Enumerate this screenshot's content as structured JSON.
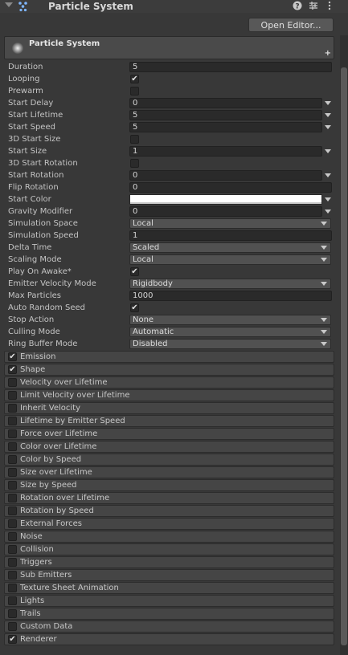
{
  "header": {
    "title": "Particle System",
    "icons": [
      "help-icon",
      "preset-icon",
      "more-icon"
    ]
  },
  "open_editor_label": "Open Editor...",
  "main_module": {
    "title": "Particle System"
  },
  "properties": [
    {
      "label": "Duration",
      "type": "text",
      "value": "5"
    },
    {
      "label": "Looping",
      "type": "checkbox",
      "checked": true
    },
    {
      "label": "Prewarm",
      "type": "checkbox",
      "checked": false
    },
    {
      "label": "Start Delay",
      "type": "text-dropdown",
      "value": "0"
    },
    {
      "label": "Start Lifetime",
      "type": "text-dropdown",
      "value": "5"
    },
    {
      "label": "Start Speed",
      "type": "text-dropdown",
      "value": "5"
    },
    {
      "label": "3D Start Size",
      "type": "checkbox",
      "checked": false
    },
    {
      "label": "Start Size",
      "type": "text-dropdown",
      "value": "1"
    },
    {
      "label": "3D Start Rotation",
      "type": "checkbox",
      "checked": false
    },
    {
      "label": "Start Rotation",
      "type": "text-dropdown",
      "value": "0"
    },
    {
      "label": "Flip Rotation",
      "type": "text",
      "value": "0"
    },
    {
      "label": "Start Color",
      "type": "color",
      "color": "#ffffff"
    },
    {
      "label": "Gravity Modifier",
      "type": "text-dropdown",
      "value": "0"
    },
    {
      "label": "Simulation Space",
      "type": "popup",
      "value": "Local"
    },
    {
      "label": "Simulation Speed",
      "type": "text",
      "value": "1"
    },
    {
      "label": "Delta Time",
      "type": "popup",
      "value": "Scaled"
    },
    {
      "label": "Scaling Mode",
      "type": "popup",
      "value": "Local"
    },
    {
      "label": "Play On Awake*",
      "type": "checkbox",
      "checked": true
    },
    {
      "label": "Emitter Velocity Mode",
      "type": "popup",
      "value": "Rigidbody"
    },
    {
      "label": "Max Particles",
      "type": "text",
      "value": "1000"
    },
    {
      "label": "Auto Random Seed",
      "type": "checkbox",
      "checked": true
    },
    {
      "label": "Stop Action",
      "type": "popup",
      "value": "None"
    },
    {
      "label": "Culling Mode",
      "type": "popup",
      "value": "Automatic"
    },
    {
      "label": "Ring Buffer Mode",
      "type": "popup",
      "value": "Disabled"
    }
  ],
  "modules": [
    {
      "name": "Emission",
      "enabled": true
    },
    {
      "name": "Shape",
      "enabled": true
    },
    {
      "name": "Velocity over Lifetime",
      "enabled": false
    },
    {
      "name": "Limit Velocity over Lifetime",
      "enabled": false
    },
    {
      "name": "Inherit Velocity",
      "enabled": false
    },
    {
      "name": "Lifetime by Emitter Speed",
      "enabled": false
    },
    {
      "name": "Force over Lifetime",
      "enabled": false
    },
    {
      "name": "Color over Lifetime",
      "enabled": false
    },
    {
      "name": "Color by Speed",
      "enabled": false
    },
    {
      "name": "Size over Lifetime",
      "enabled": false
    },
    {
      "name": "Size by Speed",
      "enabled": false
    },
    {
      "name": "Rotation over Lifetime",
      "enabled": false
    },
    {
      "name": "Rotation by Speed",
      "enabled": false
    },
    {
      "name": "External Forces",
      "enabled": false
    },
    {
      "name": "Noise",
      "enabled": false
    },
    {
      "name": "Collision",
      "enabled": false
    },
    {
      "name": "Triggers",
      "enabled": false
    },
    {
      "name": "Sub Emitters",
      "enabled": false
    },
    {
      "name": "Texture Sheet Animation",
      "enabled": false
    },
    {
      "name": "Lights",
      "enabled": false
    },
    {
      "name": "Trails",
      "enabled": false
    },
    {
      "name": "Custom Data",
      "enabled": false
    },
    {
      "name": "Renderer",
      "enabled": true
    }
  ],
  "colors": {
    "panel_bg": "#383838",
    "field_bg": "#2a2a2a",
    "popup_bg": "#515151",
    "module_bg": "#454545",
    "icon_accent": "#7fb6ff"
  }
}
